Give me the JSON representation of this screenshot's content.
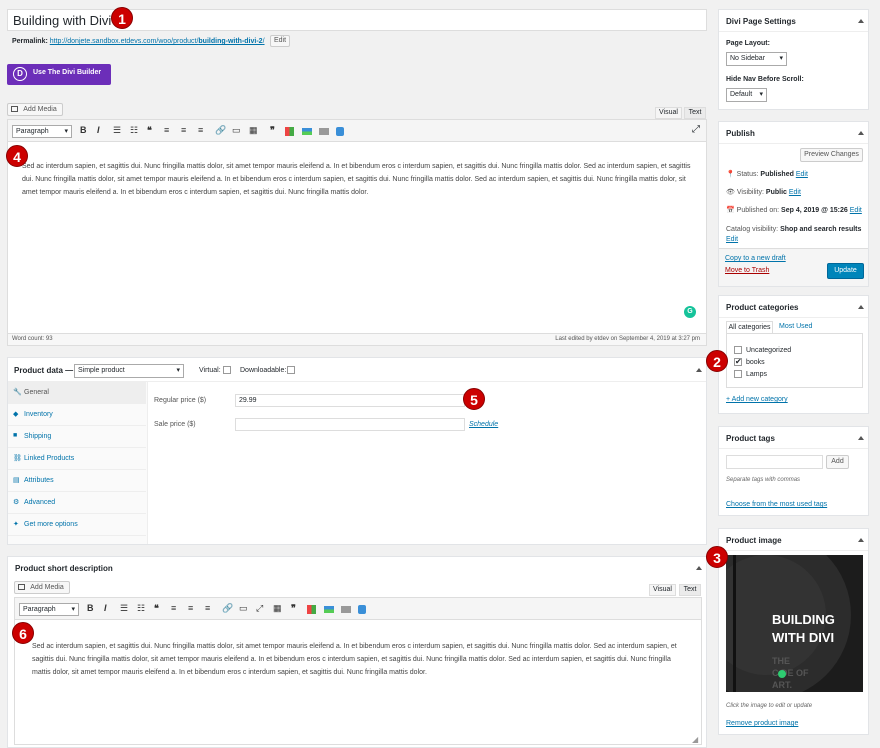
{
  "title": "Building with Divi",
  "permalink": {
    "label": "Permalink:",
    "url": "http://donjete.sandbox.etdevs.com/woo/product/",
    "slug": "building-with-divi-2",
    "suffix": "/",
    "edit": "Edit"
  },
  "divi_button": "Use The Divi Builder",
  "add_media": "Add Media",
  "visual_tab": "Visual",
  "text_tab": "Text",
  "format_select": "Paragraph",
  "content": "Sed ac interdum sapien, et sagittis dui. Nunc fringilla mattis dolor, sit amet tempor mauris eleifend a. In et bibendum eros c interdum sapien, et sagittis dui. Nunc fringilla mattis dolor. Sed ac interdum sapien, et sagittis dui. Nunc fringilla mattis dolor, sit amet tempor mauris eleifend a. In et bibendum eros c interdum sapien, et sagittis dui. Nunc fringilla mattis dolor. Sed ac interdum sapien, et sagittis dui. Nunc fringilla mattis dolor, sit amet tempor mauris eleifend a. In et bibendum eros c interdum sapien, et sagittis dui. Nunc fringilla mattis dolor.",
  "word_count": "Word count: 93",
  "last_edited": "Last edited by etdev on September 4, 2019 at 3:27 pm",
  "product_data": {
    "label": "Product data —",
    "type": "Simple product",
    "virtual": "Virtual:",
    "downloadable": "Downloadable:",
    "tabs": [
      "General",
      "Inventory",
      "Shipping",
      "Linked Products",
      "Attributes",
      "Advanced",
      "Get more options"
    ],
    "regular_label": "Regular price ($)",
    "regular_value": "29.99",
    "sale_label": "Sale price ($)",
    "sale_value": "",
    "schedule": "Schedule"
  },
  "short_desc": {
    "title": "Product short description",
    "add_media": "Add Media",
    "visual": "Visual",
    "text": "Text",
    "format": "Paragraph",
    "content": "Sed ac interdum sapien, et sagittis dui. Nunc fringilla mattis dolor, sit amet tempor mauris eleifend a. In et bibendum eros c interdum sapien, et sagittis dui. Nunc fringilla mattis dolor. Sed ac interdum sapien, et sagittis dui. Nunc fringilla mattis dolor, sit amet tempor mauris eleifend a. In et bibendum eros c interdum sapien, et sagittis dui. Nunc fringilla mattis dolor. Sed ac interdum sapien, et sagittis dui. Nunc fringilla mattis dolor, sit amet tempor mauris eleifend a. In et bibendum eros c interdum sapien, et sagittis dui. Nunc fringilla mattis dolor."
  },
  "divi_settings": {
    "title": "Divi Page Settings",
    "layout_label": "Page Layout:",
    "layout_value": "No Sidebar",
    "nav_label": "Hide Nav Before Scroll:",
    "nav_value": "Default"
  },
  "publish": {
    "title": "Publish",
    "preview": "Preview Changes",
    "status_label": "Status:",
    "status_value": "Published",
    "visibility_label": "Visibility:",
    "visibility_value": "Public",
    "published_label": "Published on:",
    "published_value": "Sep 4, 2019 @ 15:26",
    "catalog_label": "Catalog visibility:",
    "catalog_value": "Shop and search results",
    "edit": "Edit",
    "copy": "Copy to a new draft",
    "trash": "Move to Trash",
    "update": "Update"
  },
  "categories": {
    "title": "Product categories",
    "tab_all": "All categories",
    "tab_used": "Most Used",
    "items": [
      {
        "label": "Uncategorized",
        "checked": false
      },
      {
        "label": "books",
        "checked": true
      },
      {
        "label": "Lamps",
        "checked": false
      }
    ],
    "add": "+ Add new category"
  },
  "tags": {
    "title": "Product tags",
    "add": "Add",
    "hint": "Separate tags with commas",
    "choose": "Choose from the most used tags"
  },
  "image": {
    "title": "Product image",
    "line1": "BUILDING",
    "line2": "WITH DIVI",
    "line3": "THE",
    "line4": "C  DE OF",
    "line5": "ART.",
    "hint": "Click the image to edit or update",
    "remove": "Remove product image"
  },
  "badges": [
    "1",
    "2",
    "3",
    "4",
    "5",
    "6"
  ],
  "colors": {
    "divi_purple": "#6c2eb9",
    "link": "#0073aa",
    "update_blue": "#0085ba",
    "trash_red": "#a00",
    "badge_red": "#c00"
  }
}
